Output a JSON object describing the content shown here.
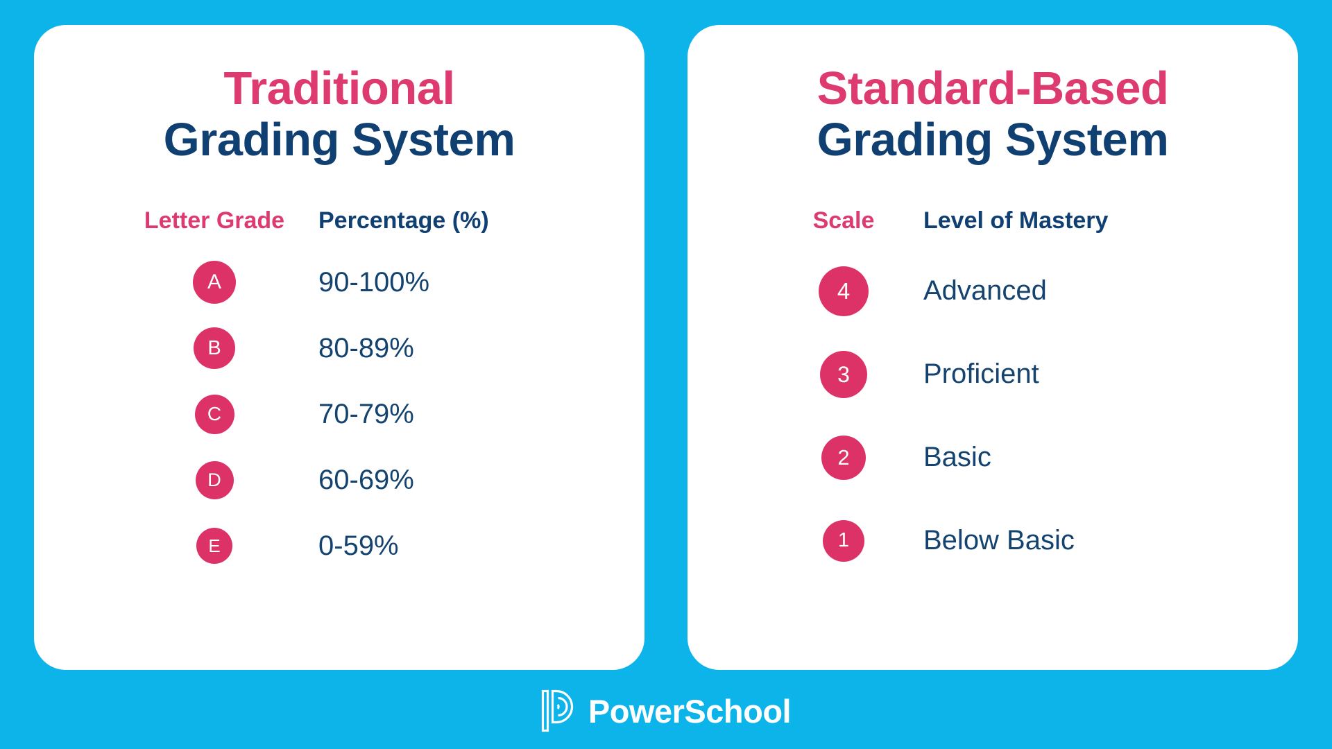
{
  "background_color": "#0cb4ea",
  "accent_pink": "#dd3b6f",
  "accent_navy": "#103f72",
  "badge_pink": "#dd3268",
  "cards": [
    {
      "title_line1": "Traditional",
      "title_line2": "Grading System",
      "header_left": "Letter Grade",
      "header_right": "Percentage (%)",
      "rows": [
        {
          "badge": "A",
          "value": "90-100%"
        },
        {
          "badge": "B",
          "value": "80-89%"
        },
        {
          "badge": "C",
          "value": "70-79%"
        },
        {
          "badge": "D",
          "value": "60-69%"
        },
        {
          "badge": "E",
          "value": "0-59%"
        }
      ]
    },
    {
      "title_line1": "Standard-Based",
      "title_line2": "Grading System",
      "header_left": "Scale",
      "header_right": "Level of Mastery",
      "rows": [
        {
          "badge": "4",
          "value": "Advanced"
        },
        {
          "badge": "3",
          "value": "Proficient"
        },
        {
          "badge": "2",
          "value": "Basic"
        },
        {
          "badge": "1",
          "value": "Below Basic"
        }
      ]
    }
  ],
  "footer": {
    "logo_icon": "powerschool-p-logo-icon",
    "brand_name": "PowerSchool"
  }
}
